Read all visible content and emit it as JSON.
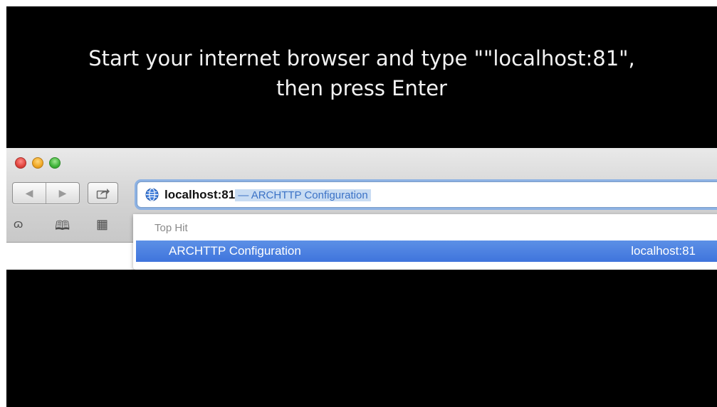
{
  "caption": {
    "line1": "Start your internet browser and type \"\"localhost:81\",",
    "line2": "then  press Enter"
  },
  "browser": {
    "nav": {
      "back_icon": "back-arrow",
      "back_label": "◀",
      "forward_icon": "forward-arrow",
      "forward_label": "▶",
      "share_icon": "share-arrow"
    },
    "address_bar": {
      "typed_text": "localhost:81",
      "autocomplete_text": " — ARCHTTP Configuration",
      "site_icon": "globe-icon"
    },
    "bookmarks_bar": {
      "reading_list_icon": "glasses-icon",
      "reading_list_glyph": "ɷ",
      "bookmarks_icon": "book-icon",
      "bookmarks_glyph": "🕮",
      "top_sites_icon": "grid-icon",
      "top_sites_glyph": "▦"
    },
    "suggestions": {
      "header": "Top Hit",
      "items": [
        {
          "title": "ARCHTTP Configuration",
          "url": "localhost:81",
          "selected": true
        }
      ]
    }
  },
  "colors": {
    "background": "#000000",
    "caption_text": "#f2f2f2",
    "selection_blue": "#3f74dc",
    "autocomplete_highlight": "#c8dcf3"
  }
}
